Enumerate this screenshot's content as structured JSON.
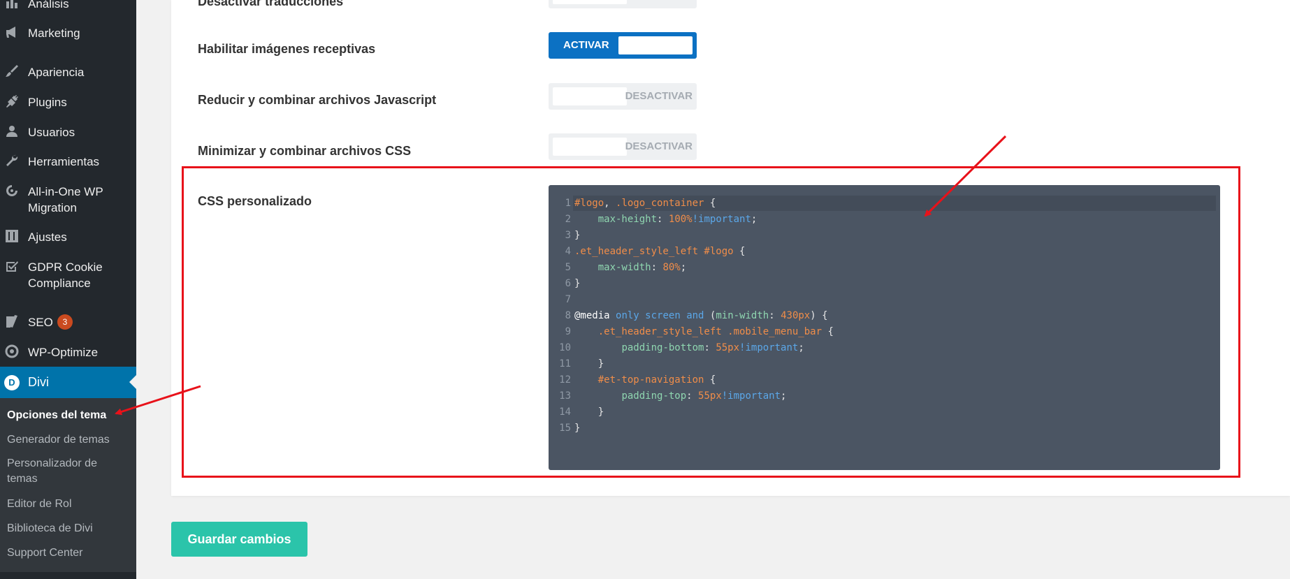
{
  "sidebar": {
    "items": [
      {
        "label": "Análisis",
        "icon": "chart-bar-icon"
      },
      {
        "label": "Marketing",
        "icon": "megaphone-icon"
      },
      {
        "label": "Apariencia",
        "icon": "paintbrush-icon"
      },
      {
        "label": "Plugins",
        "icon": "plug-icon"
      },
      {
        "label": "Usuarios",
        "icon": "user-icon"
      },
      {
        "label": "Herramientas",
        "icon": "wrench-icon"
      },
      {
        "label": "All-in-One WP Migration",
        "icon": "migration-icon"
      },
      {
        "label": "Ajustes",
        "icon": "settings-sliders-icon"
      },
      {
        "label": "GDPR Cookie Compliance",
        "icon": "checkbox-icon"
      },
      {
        "label": "SEO",
        "icon": "yoast-icon",
        "badge": "3"
      },
      {
        "label": "WP-Optimize",
        "icon": "optimize-icon"
      }
    ],
    "active": {
      "label": "Divi",
      "icon_letter": "D"
    },
    "submenu": [
      {
        "label": "Opciones del tema",
        "current": true
      },
      {
        "label": "Generador de temas"
      },
      {
        "label": "Personalizador de temas"
      },
      {
        "label": "Editor de Rol"
      },
      {
        "label": "Biblioteca de Divi"
      },
      {
        "label": "Support Center"
      }
    ]
  },
  "options": [
    {
      "label": "Desactivar traducciones"
    },
    {
      "label": "Habilitar imágenes receptivas",
      "state": "ACTIVAR"
    },
    {
      "label": "Reducir y combinar archivos Javascript",
      "state": "DESACTIVAR"
    },
    {
      "label": "Minimizar y combinar archivos CSS",
      "state": "DESACTIVAR"
    }
  ],
  "custom_css": {
    "label": "CSS personalizado",
    "lines": [
      "#logo, .logo_container {",
      "    max-height: 100%!important;",
      "}",
      ".et_header_style_left #logo {",
      "    max-width: 80%;",
      "}",
      "",
      "@media only screen and (min-width: 430px) {",
      "    .et_header_style_left .mobile_menu_bar {",
      "        padding-bottom: 55px!important;",
      "    }",
      "    #et-top-navigation {",
      "        padding-top: 55px!important;",
      "    }",
      "}"
    ]
  },
  "save_button": "Guardar cambios",
  "colors": {
    "sidebar_bg": "#23282d",
    "active_menu": "#0073aa",
    "toggle_on": "#0c71c3",
    "save_button": "#2bc4aa",
    "annotation": "#e8121a",
    "editor_bg": "#4b5563"
  }
}
